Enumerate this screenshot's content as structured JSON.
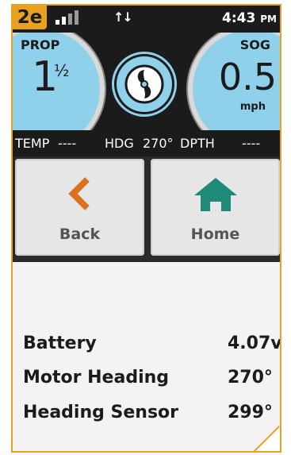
{
  "status_bar": {
    "badge": "2e",
    "time": "4:43",
    "ampm": "PM",
    "signal_icon": "signal-bars-icon",
    "data_icon": "data-transfer-arrows-icon",
    "arrows": "↑↓"
  },
  "gauges": {
    "prop_label": "PROP",
    "prop_value": "1",
    "prop_fraction": "½",
    "sog_label": "SOG",
    "sog_value": "0.5",
    "sog_unit": "mph",
    "center_icon": "propeller-icon"
  },
  "info_bar": {
    "temp_label": "TEMP",
    "temp_value": "----",
    "hdg_label": "HDG",
    "hdg_value": "270°",
    "dpth_label": "DPTH",
    "dpth_value": "----"
  },
  "nav": {
    "back_label": "Back",
    "home_label": "Home",
    "back_icon": "chevron-left-icon",
    "home_icon": "home-icon"
  },
  "readings": [
    {
      "label": "Battery",
      "value": "4.07v"
    },
    {
      "label": "Motor Heading",
      "value": "270°"
    },
    {
      "label": "Heading Sensor",
      "value": "299°"
    }
  ],
  "colors": {
    "accent": "#e8a21f",
    "dial": "#8fd0ea",
    "back_icon": "#d9731f",
    "home_icon": "#1f8a78"
  }
}
